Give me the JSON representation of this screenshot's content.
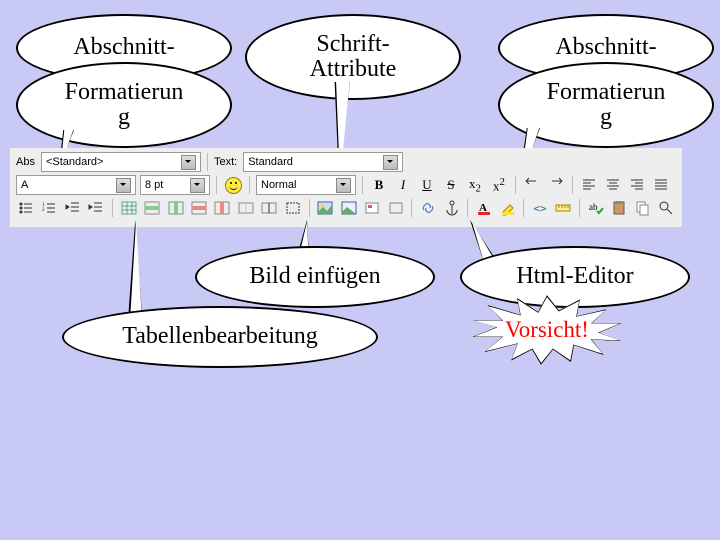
{
  "callouts": {
    "abschnitt_left": "Abschnitt-",
    "formatierung_left_a": "Formatierun",
    "formatierung_left_b": "g",
    "schrift_a": "Schrift-",
    "schrift_b": "Attribute",
    "abschnitt_right": "Abschnitt-",
    "formatierung_right_a": "Formatierun",
    "formatierung_right_b": "g",
    "bild": "Bild einfügen",
    "tabelle": "Tabellenbearbeitung",
    "html": "Html-Editor",
    "vorsicht": "Vorsicht!"
  },
  "toolbar": {
    "row1": {
      "abs_label": "Abs",
      "abs_value": "<Standard>",
      "text_label": "Text:",
      "text_value": "Standard"
    },
    "row2": {
      "font_value": "A",
      "size_value": "8 pt",
      "weight_value": "Normal",
      "b": "B",
      "i": "I",
      "u": "U",
      "s": "S",
      "x2": "x",
      "sup2": "2",
      "angle": "<>"
    }
  }
}
